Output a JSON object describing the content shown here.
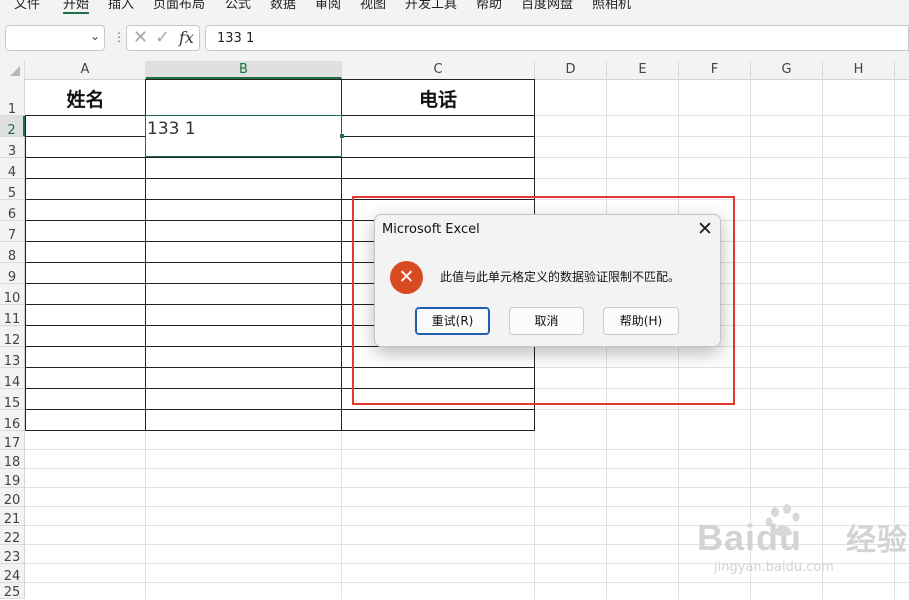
{
  "menu": {
    "items": [
      "文件",
      "开始",
      "插入",
      "页面布局",
      "公式",
      "数据",
      "审阅",
      "视图",
      "开发工具",
      "帮助",
      "百度网盘",
      "照相机"
    ],
    "active_index": 1
  },
  "formula_bar": {
    "name_box": "",
    "fx_label": "fx",
    "content": "133 1"
  },
  "columns": [
    "A",
    "B",
    "C",
    "D",
    "E",
    "F",
    "G",
    "H"
  ],
  "selected_column": "B",
  "rows": [
    "1",
    "2",
    "3",
    "4",
    "5",
    "6",
    "7",
    "8",
    "9",
    "10",
    "11",
    "12",
    "13",
    "14",
    "15",
    "16",
    "17",
    "18",
    "19",
    "20",
    "21",
    "22",
    "23",
    "24",
    "25"
  ],
  "selected_row": "2",
  "cells": {
    "A1": "姓名",
    "B1": "",
    "C1": "电话",
    "B2": "133 1"
  },
  "dialog": {
    "title": "Microsoft Excel",
    "close_symbol": "✕",
    "icon": "error-x-icon",
    "message": "此值与此单元格定义的数据验证限制不匹配。",
    "buttons": {
      "retry": "重试(R)",
      "cancel": "取消",
      "help": "帮助(H)"
    }
  },
  "colors": {
    "accent": "#1e7145",
    "error": "#d84a1f",
    "annotation": "#e23a32"
  },
  "watermark": {
    "logo": "Baidu",
    "brand": "经验",
    "url": "jingyan.baidu.com"
  }
}
